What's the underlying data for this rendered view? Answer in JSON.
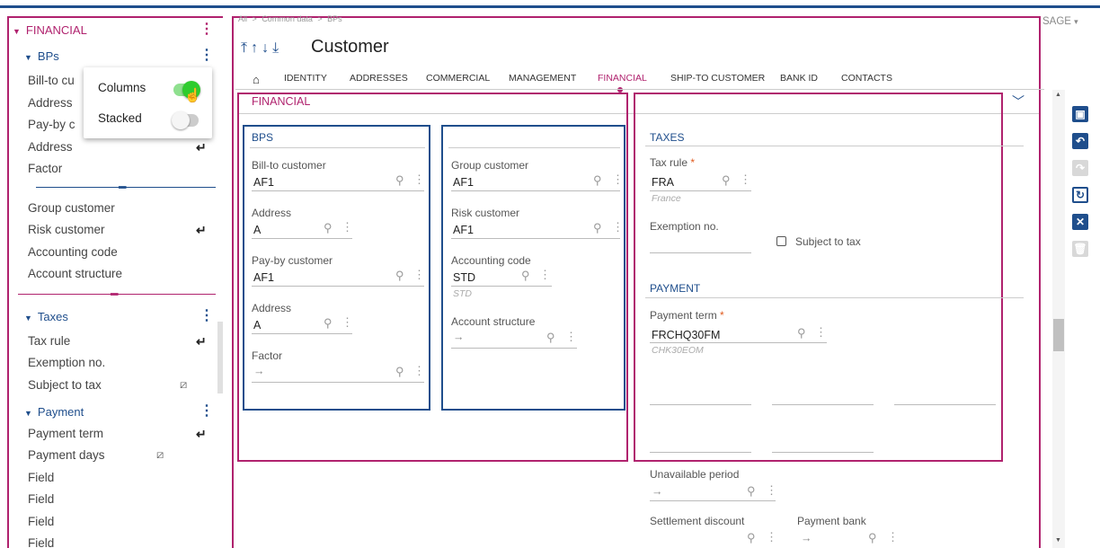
{
  "breadcrumb": {
    "all": "All",
    "sep1": ">",
    "common": "Common data",
    "sep2": ">",
    "current": "BPs"
  },
  "user_menu": {
    "label": "SAGE",
    "caret": "▾"
  },
  "page": {
    "title": "Customer",
    "arrows": "⤒↑↓⤓"
  },
  "tabs": [
    {
      "label": "IDENTITY"
    },
    {
      "label": "ADDRESSES"
    },
    {
      "label": "COMMERCIAL"
    },
    {
      "label": "MANAGEMENT"
    },
    {
      "label": "FINANCIAL",
      "active": true
    },
    {
      "label": "SHIP-TO CUSTOMER"
    },
    {
      "label": "BANK ID"
    },
    {
      "label": "CONTACTS"
    }
  ],
  "sidebar": {
    "section": "FINANCIAL",
    "bps_group": "BPs",
    "bps_items": [
      "Bill-to cu",
      "Address",
      "Pay-by c",
      "Address",
      "Factor"
    ],
    "group_items": [
      "Group customer",
      "Risk customer",
      "Accounting code",
      "Account structure"
    ],
    "taxes_group": "Taxes",
    "taxes_items": [
      "Tax rule",
      "Exemption no.",
      "Subject to tax"
    ],
    "payment_group": "Payment",
    "payment_items": [
      "Payment term",
      "Payment days",
      "Field",
      "Field",
      "Field",
      "Field"
    ]
  },
  "popup": {
    "columns_label": "Columns",
    "columns_on": true,
    "stacked_label": "Stacked",
    "stacked_on": false
  },
  "financial_section": {
    "title": "FINANCIAL"
  },
  "bps_block": {
    "title": "BPS",
    "bill_to_label": "Bill-to customer",
    "bill_to_value": "AF1",
    "address1_label": "Address",
    "address1_value": "A",
    "pay_by_label": "Pay-by customer",
    "pay_by_value": "AF1",
    "address2_label": "Address",
    "address2_value": "A",
    "factor_label": "Factor",
    "factor_value": "→"
  },
  "group_block": {
    "group_label": "Group customer",
    "group_value": "AF1",
    "risk_label": "Risk customer",
    "risk_value": "AF1",
    "acct_label": "Accounting code",
    "acct_value": "STD",
    "acct_sub": "STD",
    "struct_label": "Account structure",
    "struct_value": "→"
  },
  "taxes_block": {
    "title": "TAXES",
    "tax_rule_label": "Tax rule",
    "tax_rule_value": "FRA",
    "tax_rule_sub": "France",
    "exemption_label": "Exemption no.",
    "subject_label": "Subject to tax",
    "required_mark": "*"
  },
  "payment_block": {
    "title": "PAYMENT",
    "term_label": "Payment term",
    "term_value": "FRCHQ30FM",
    "term_sub": "CHK30EOM",
    "unavail_label": "Unavailable period",
    "unavail_value": "→",
    "settle_label": "Settlement discount",
    "bank_label": "Payment bank",
    "bank_value": "→"
  },
  "icons": {
    "search": "magnifier-icon",
    "more": "kebab-icon",
    "home": "home-icon"
  },
  "colors": {
    "accent": "#b0226e",
    "primary": "#1f4e8c",
    "toggle_on": "#2ecc2e"
  }
}
